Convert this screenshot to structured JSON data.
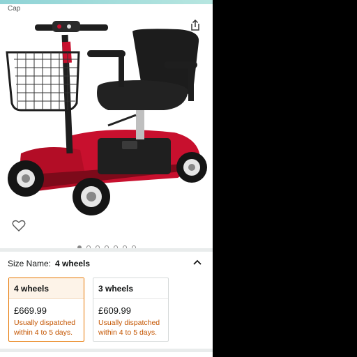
{
  "breadcrumb": "Cap",
  "gallery": {
    "image_alt": "Red 4-wheel mobility scooter with black seat and front basket",
    "dot_count": 7,
    "active_dot": 0
  },
  "size_selector": {
    "label": "Size Name:",
    "selected": "4 wheels",
    "options": [
      {
        "name": "4 wheels",
        "price": "£669.99",
        "dispatch": "Usually dispatched within 4 to 5 days."
      },
      {
        "name": "3 wheels",
        "price": "£609.99",
        "dispatch": "Usually dispatched within 4 to 5 days."
      }
    ]
  },
  "icons": {
    "share": "share-icon",
    "favorite": "heart-icon",
    "collapse": "chevron-up-icon"
  },
  "colors": {
    "accent_orange": "#e77600",
    "dispatch_text": "#c45500",
    "scooter_red": "#c8102e"
  }
}
